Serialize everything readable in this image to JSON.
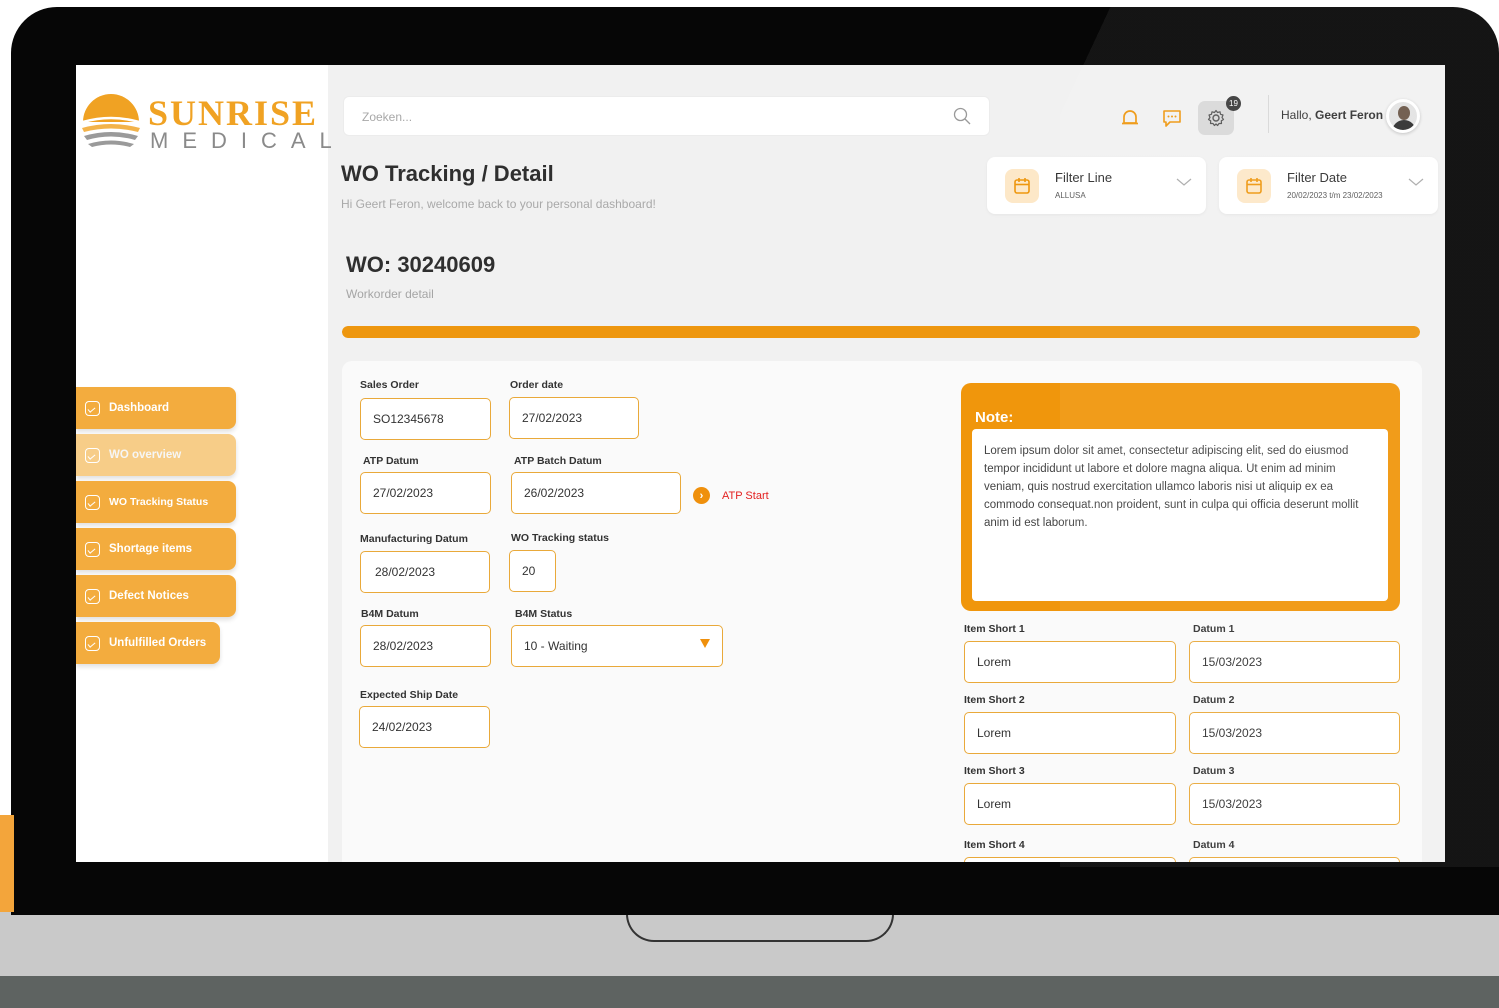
{
  "brand": {
    "name_top": "SUNRISE",
    "name_bottom": "MEDICAL"
  },
  "sidebar": {
    "items": [
      {
        "label": "Dashboard"
      },
      {
        "label": "WO overview"
      },
      {
        "label": "WO Tracking Status"
      },
      {
        "label": "Shortage items"
      },
      {
        "label": "Defect Notices"
      },
      {
        "label": "Unfulfilled Orders"
      }
    ],
    "active_index": 1
  },
  "header": {
    "search_placeholder": "Zoeken...",
    "notification_badge": "19",
    "greeting_prefix": "Hallo, ",
    "user_name": "Geert Feron"
  },
  "page": {
    "title": "WO Tracking / Detail",
    "subtitle": "Hi Geert Feron, welcome back to your personal dashboard!"
  },
  "filters": [
    {
      "title": "Filter Line",
      "value": "ALLUSA"
    },
    {
      "title": "Filter Date",
      "value": "20/02/2023 t/m 23/02/2023"
    }
  ],
  "workorder": {
    "title": "WO: 30240609",
    "subtitle": "Workorder detail",
    "progress_percent": 100
  },
  "form": {
    "sales_order": {
      "label": "Sales Order",
      "value": "SO12345678"
    },
    "order_date": {
      "label": "Order date",
      "value": "27/02/2023"
    },
    "atp_datum": {
      "label": "ATP Datum",
      "value": "27/02/2023"
    },
    "atp_batch_datum": {
      "label": "ATP Batch Datum",
      "value": "26/02/2023"
    },
    "atp_start": {
      "label": "ATP Start"
    },
    "manufacturing_datum": {
      "label": "Manufacturing Datum",
      "value": "28/02/2023"
    },
    "wo_tracking_status": {
      "label": "WO Tracking status",
      "value": "20"
    },
    "b4m_datum": {
      "label": "B4M Datum",
      "value": "28/02/2023"
    },
    "b4m_status": {
      "label": "B4M Status",
      "value": "10 - Waiting"
    },
    "expected_ship_date": {
      "label": "Expected Ship Date",
      "value": "24/02/2023"
    }
  },
  "note": {
    "title": "Note:",
    "text": "Lorem ipsum dolor sit amet, consectetur adipiscing elit, sed do eiusmod tempor incididunt ut labore et dolore magna aliqua. Ut enim ad minim veniam, quis nostrud exercitation ullamco laboris nisi ut aliquip ex ea commodo consequat.non proident, sunt in culpa qui officia deserunt mollit anim id est laborum."
  },
  "short_items": [
    {
      "item_label": "Item Short 1",
      "item_value": "Lorem",
      "date_label": "Datum 1",
      "date_value": "15/03/2023"
    },
    {
      "item_label": "Item Short 2",
      "item_value": "Lorem",
      "date_label": "Datum 2",
      "date_value": "15/03/2023"
    },
    {
      "item_label": "Item Short 3",
      "item_value": "Lorem",
      "date_label": "Datum 3",
      "date_value": "15/03/2023"
    },
    {
      "item_label": "Item Short 4",
      "item_value": "",
      "date_label": "Datum 4",
      "date_value": ""
    }
  ],
  "colors": {
    "accent": "#ee970f",
    "nav": "#f3ac3e",
    "nav_active": "#f7cd88",
    "atp_start_text": "#e32020"
  }
}
